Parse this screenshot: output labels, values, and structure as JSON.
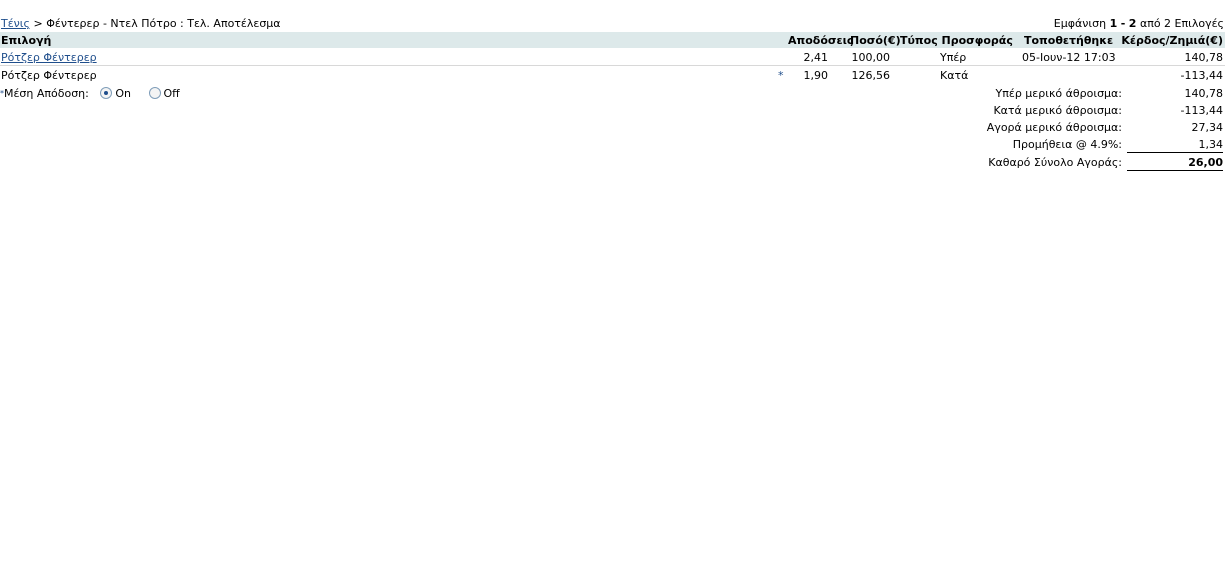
{
  "breadcrumb": {
    "sport": "Τένις",
    "separator": ">",
    "event": "Φέντερερ - Ντελ Πότρο : Τελ. Αποτέλεσμα"
  },
  "range": {
    "prefix": "Εμφάνιση",
    "from": "1",
    "dash": "-",
    "to": "2",
    "of": "από 2 Επιλογές"
  },
  "table": {
    "headers": {
      "selection": "Επιλογή",
      "odds": "Αποδόσεις",
      "amount": "Ποσό(€)",
      "bet_type": "Τύπος Προσφοράς",
      "placed": "Τοποθετήθηκε",
      "profit_loss": "Κέρδος/Ζημιά(€)"
    },
    "rows": [
      {
        "selection": "Ρότζερ Φέντερερ",
        "marker": "",
        "odds": "2,41",
        "amount": "100,00",
        "bet_type": "Υπέρ",
        "placed": "05-Ιουν-12 17:03",
        "profit_loss": "140,78"
      },
      {
        "selection": "Ρότζερ Φέντερερ",
        "marker": "*",
        "odds": "1,90",
        "amount": "126,56",
        "bet_type": "Κατά",
        "placed": "",
        "profit_loss": "-113,44"
      }
    ]
  },
  "average_odds": {
    "mark": "*",
    "label": "Μέση Απόδοση:",
    "on_label": "On",
    "off_label": "Off",
    "selected": "On"
  },
  "summary": {
    "back_subtotal_label": "Υπέρ μερικό άθροισμα:",
    "back_subtotal_value": "140,78",
    "lay_subtotal_label": "Κατά μερικό άθροισμα:",
    "lay_subtotal_value": "-113,44",
    "market_subtotal_label": "Αγορά μερικό άθροισμα:",
    "market_subtotal_value": "27,34",
    "commission_label": "Προμήθεια @ 4.9%:",
    "commission_value": "1,34",
    "net_total_label": "Καθαρό Σύνολο Αγοράς:",
    "net_total_value": "26,00"
  },
  "colors": {
    "header_bg": "#dde9ea",
    "link": "#1f4e8c"
  }
}
